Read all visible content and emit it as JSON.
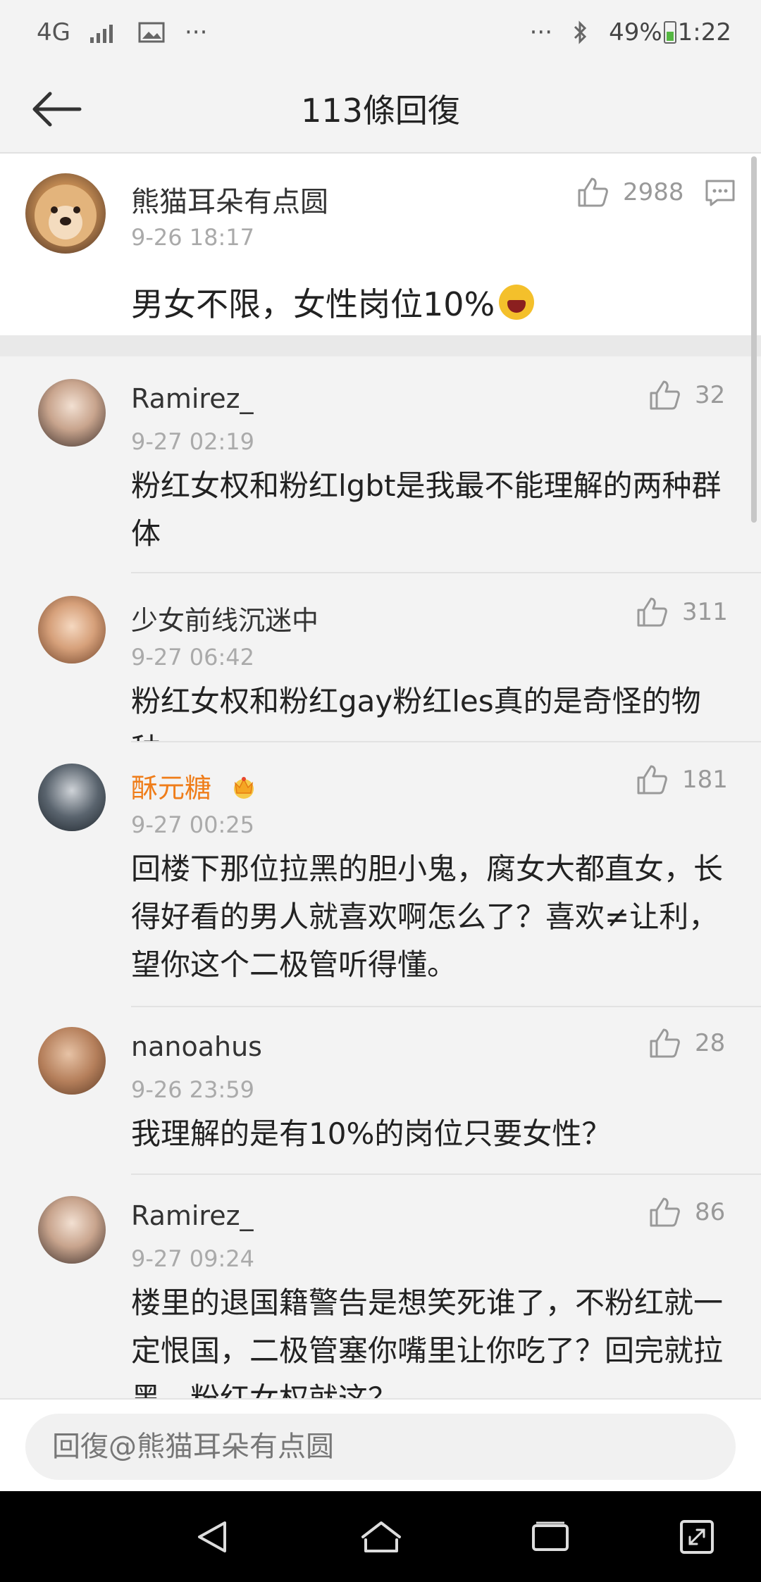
{
  "status_bar": {
    "network": "4G",
    "more_left": "···",
    "more_right": "···",
    "battery": "49%",
    "time": "1:22"
  },
  "header": {
    "title": "113條回復"
  },
  "main_comment": {
    "author": "熊猫耳朵有点圆",
    "time": "9-26 18:17",
    "text": "男女不限，女性岗位10%",
    "likes": "2988"
  },
  "replies": [
    {
      "author": "Ramirez_",
      "time": "9-27 02:19",
      "text": "粉红女权和粉红lgbt是我最不能理解的两种群体",
      "likes": "32"
    },
    {
      "author": "少女前线沉迷中",
      "time": "9-27 06:42",
      "text": "粉红女权和粉红gay粉红les真的是奇怪的物种",
      "likes": "311"
    },
    {
      "author": "酥元糖",
      "time": "9-27 00:25",
      "text": "回楼下那位拉黑的胆小鬼，腐女大都直女，长得好看的男人就喜欢啊怎么了？喜欢≠让利，望你这个二极管听得懂。",
      "likes": "181"
    },
    {
      "author": "nanoahus",
      "time": "9-26 23:59",
      "text": "我理解的是有10%的岗位只要女性？",
      "likes": "28"
    },
    {
      "author": "Ramirez_",
      "time": "9-27 09:24",
      "text": "楼里的退国籍警告是想笑死谁了，不粉红就一定恨国，二极管塞你嘴里让你吃了？回完就拉黑，粉红女权就这？",
      "likes": "86"
    }
  ],
  "reply_box": {
    "placeholder": "回復@熊猫耳朵有点圆"
  },
  "colors": {
    "vip_name": "#ef7d1a",
    "background": "#f3f3f3"
  }
}
